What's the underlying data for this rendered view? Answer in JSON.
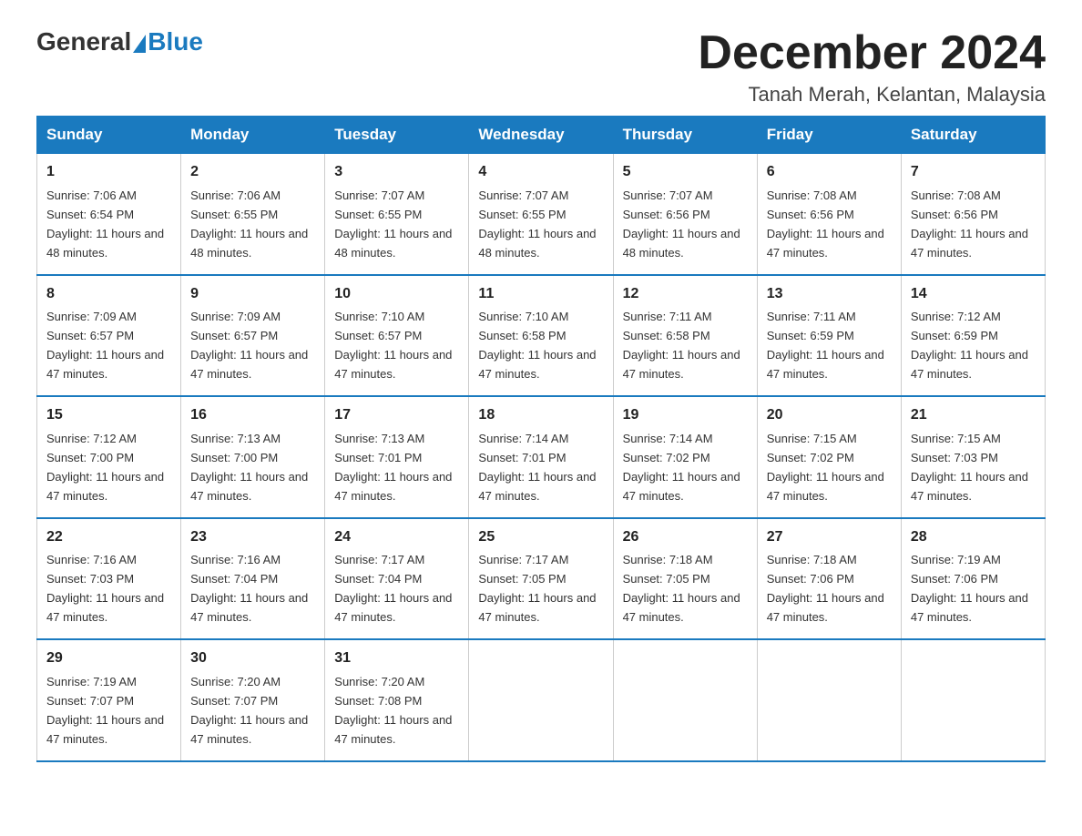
{
  "header": {
    "logo": {
      "general": "General",
      "blue": "Blue"
    },
    "title": "December 2024",
    "subtitle": "Tanah Merah, Kelantan, Malaysia"
  },
  "days_header": [
    "Sunday",
    "Monday",
    "Tuesday",
    "Wednesday",
    "Thursday",
    "Friday",
    "Saturday"
  ],
  "weeks": [
    [
      {
        "day": "1",
        "sunrise": "7:06 AM",
        "sunset": "6:54 PM",
        "daylight": "11 hours and 48 minutes."
      },
      {
        "day": "2",
        "sunrise": "7:06 AM",
        "sunset": "6:55 PM",
        "daylight": "11 hours and 48 minutes."
      },
      {
        "day": "3",
        "sunrise": "7:07 AM",
        "sunset": "6:55 PM",
        "daylight": "11 hours and 48 minutes."
      },
      {
        "day": "4",
        "sunrise": "7:07 AM",
        "sunset": "6:55 PM",
        "daylight": "11 hours and 48 minutes."
      },
      {
        "day": "5",
        "sunrise": "7:07 AM",
        "sunset": "6:56 PM",
        "daylight": "11 hours and 48 minutes."
      },
      {
        "day": "6",
        "sunrise": "7:08 AM",
        "sunset": "6:56 PM",
        "daylight": "11 hours and 47 minutes."
      },
      {
        "day": "7",
        "sunrise": "7:08 AM",
        "sunset": "6:56 PM",
        "daylight": "11 hours and 47 minutes."
      }
    ],
    [
      {
        "day": "8",
        "sunrise": "7:09 AM",
        "sunset": "6:57 PM",
        "daylight": "11 hours and 47 minutes."
      },
      {
        "day": "9",
        "sunrise": "7:09 AM",
        "sunset": "6:57 PM",
        "daylight": "11 hours and 47 minutes."
      },
      {
        "day": "10",
        "sunrise": "7:10 AM",
        "sunset": "6:57 PM",
        "daylight": "11 hours and 47 minutes."
      },
      {
        "day": "11",
        "sunrise": "7:10 AM",
        "sunset": "6:58 PM",
        "daylight": "11 hours and 47 minutes."
      },
      {
        "day": "12",
        "sunrise": "7:11 AM",
        "sunset": "6:58 PM",
        "daylight": "11 hours and 47 minutes."
      },
      {
        "day": "13",
        "sunrise": "7:11 AM",
        "sunset": "6:59 PM",
        "daylight": "11 hours and 47 minutes."
      },
      {
        "day": "14",
        "sunrise": "7:12 AM",
        "sunset": "6:59 PM",
        "daylight": "11 hours and 47 minutes."
      }
    ],
    [
      {
        "day": "15",
        "sunrise": "7:12 AM",
        "sunset": "7:00 PM",
        "daylight": "11 hours and 47 minutes."
      },
      {
        "day": "16",
        "sunrise": "7:13 AM",
        "sunset": "7:00 PM",
        "daylight": "11 hours and 47 minutes."
      },
      {
        "day": "17",
        "sunrise": "7:13 AM",
        "sunset": "7:01 PM",
        "daylight": "11 hours and 47 minutes."
      },
      {
        "day": "18",
        "sunrise": "7:14 AM",
        "sunset": "7:01 PM",
        "daylight": "11 hours and 47 minutes."
      },
      {
        "day": "19",
        "sunrise": "7:14 AM",
        "sunset": "7:02 PM",
        "daylight": "11 hours and 47 minutes."
      },
      {
        "day": "20",
        "sunrise": "7:15 AM",
        "sunset": "7:02 PM",
        "daylight": "11 hours and 47 minutes."
      },
      {
        "day": "21",
        "sunrise": "7:15 AM",
        "sunset": "7:03 PM",
        "daylight": "11 hours and 47 minutes."
      }
    ],
    [
      {
        "day": "22",
        "sunrise": "7:16 AM",
        "sunset": "7:03 PM",
        "daylight": "11 hours and 47 minutes."
      },
      {
        "day": "23",
        "sunrise": "7:16 AM",
        "sunset": "7:04 PM",
        "daylight": "11 hours and 47 minutes."
      },
      {
        "day": "24",
        "sunrise": "7:17 AM",
        "sunset": "7:04 PM",
        "daylight": "11 hours and 47 minutes."
      },
      {
        "day": "25",
        "sunrise": "7:17 AM",
        "sunset": "7:05 PM",
        "daylight": "11 hours and 47 minutes."
      },
      {
        "day": "26",
        "sunrise": "7:18 AM",
        "sunset": "7:05 PM",
        "daylight": "11 hours and 47 minutes."
      },
      {
        "day": "27",
        "sunrise": "7:18 AM",
        "sunset": "7:06 PM",
        "daylight": "11 hours and 47 minutes."
      },
      {
        "day": "28",
        "sunrise": "7:19 AM",
        "sunset": "7:06 PM",
        "daylight": "11 hours and 47 minutes."
      }
    ],
    [
      {
        "day": "29",
        "sunrise": "7:19 AM",
        "sunset": "7:07 PM",
        "daylight": "11 hours and 47 minutes."
      },
      {
        "day": "30",
        "sunrise": "7:20 AM",
        "sunset": "7:07 PM",
        "daylight": "11 hours and 47 minutes."
      },
      {
        "day": "31",
        "sunrise": "7:20 AM",
        "sunset": "7:08 PM",
        "daylight": "11 hours and 47 minutes."
      },
      null,
      null,
      null,
      null
    ]
  ],
  "labels": {
    "sunrise": "Sunrise:",
    "sunset": "Sunset:",
    "daylight": "Daylight:"
  }
}
